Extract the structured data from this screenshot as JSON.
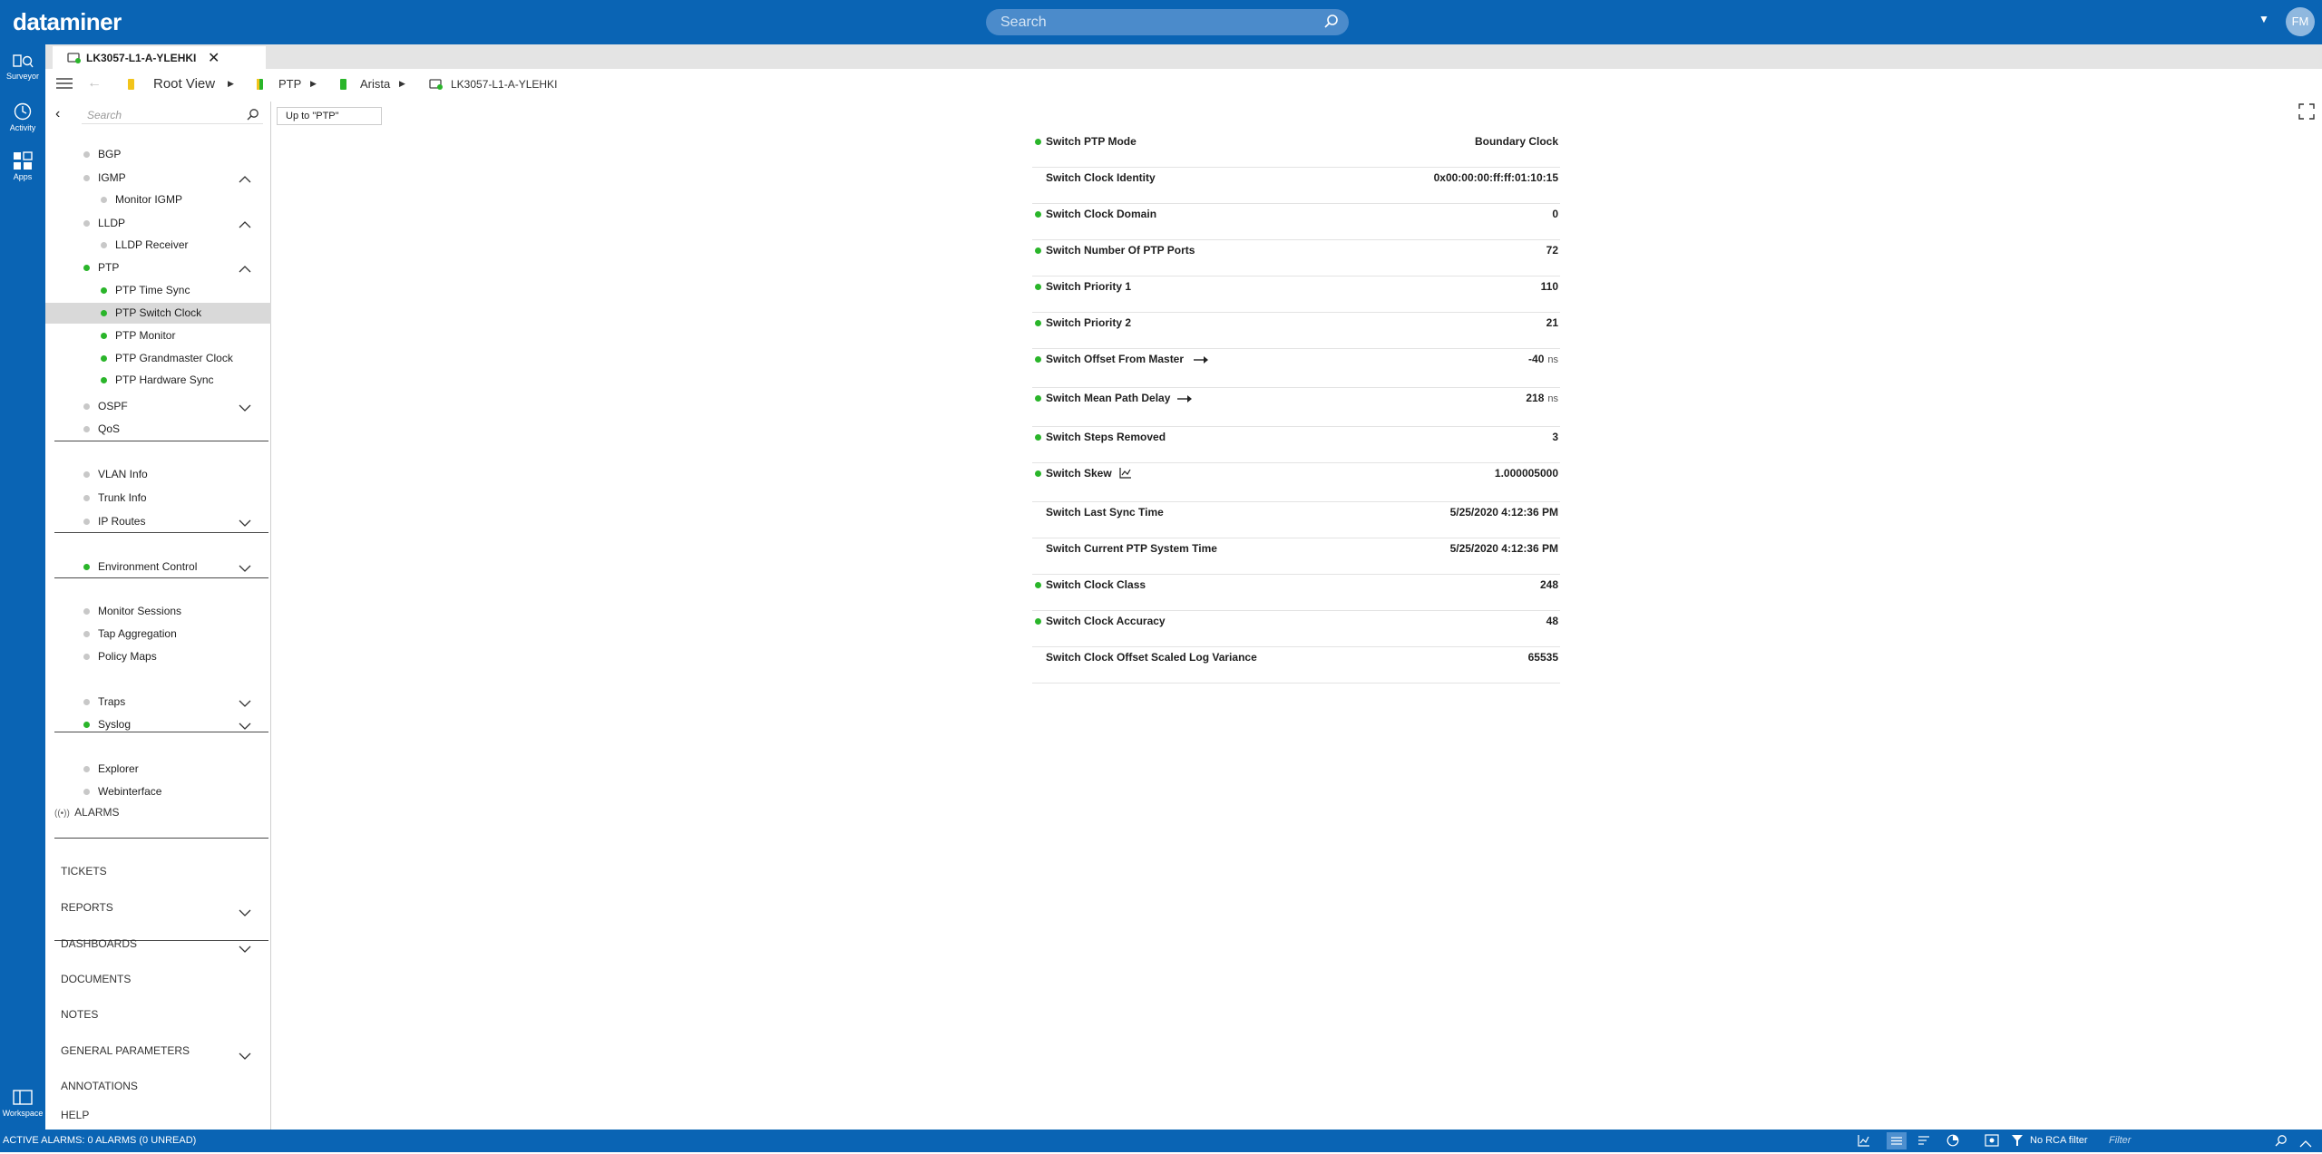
{
  "app": {
    "logo": "dataminer",
    "search_placeholder": "Search",
    "avatar_initials": "FM"
  },
  "rail": {
    "items": [
      {
        "label": "Surveyor"
      },
      {
        "label": "Activity"
      },
      {
        "label": "Apps"
      }
    ],
    "bottom": {
      "label": "Workspace"
    }
  },
  "tab": {
    "title": "LK3057-L1-A-YLEHKI"
  },
  "breadcrumb": [
    "Root View",
    "PTP",
    "Arista",
    "LK3057-L1-A-YLEHKI"
  ],
  "sidebar": {
    "search_placeholder": "Search",
    "items": [
      {
        "label": "BGP",
        "status": "grey",
        "indent": 1
      },
      {
        "label": "IGMP",
        "status": "grey",
        "indent": 1,
        "chevron": "up"
      },
      {
        "label": "Monitor IGMP",
        "status": "grey",
        "indent": 2
      },
      {
        "label": "LLDP",
        "status": "grey",
        "indent": 1,
        "chevron": "up"
      },
      {
        "label": "LLDP Receiver",
        "status": "grey",
        "indent": 2
      },
      {
        "label": "PTP",
        "status": "green",
        "indent": 1,
        "chevron": "up"
      },
      {
        "label": "PTP Time Sync",
        "status": "green",
        "indent": 2
      },
      {
        "label": "PTP Switch Clock",
        "status": "green",
        "indent": 2,
        "selected": true
      },
      {
        "label": "PTP Monitor",
        "status": "green",
        "indent": 2
      },
      {
        "label": "PTP Grandmaster Clock",
        "status": "green",
        "indent": 2
      },
      {
        "label": "PTP Hardware Sync",
        "status": "green",
        "indent": 2
      },
      {
        "label": "OSPF",
        "status": "grey",
        "indent": 1,
        "chevron": "down"
      },
      {
        "label": "QoS",
        "status": "grey",
        "indent": 1
      },
      {
        "label": "VLAN Info",
        "status": "grey",
        "indent": 1
      },
      {
        "label": "Trunk Info",
        "status": "grey",
        "indent": 1
      },
      {
        "label": "IP Routes",
        "status": "grey",
        "indent": 1,
        "chevron": "down"
      },
      {
        "label": "Environment Control",
        "status": "green",
        "indent": 1,
        "chevron": "down"
      },
      {
        "label": "Monitor Sessions",
        "status": "grey",
        "indent": 1
      },
      {
        "label": "Tap Aggregation",
        "status": "grey",
        "indent": 1
      },
      {
        "label": "Policy Maps",
        "status": "grey",
        "indent": 1
      },
      {
        "label": "Traps",
        "status": "grey",
        "indent": 1,
        "chevron": "down"
      },
      {
        "label": "Syslog",
        "status": "green",
        "indent": 1,
        "chevron": "down"
      },
      {
        "label": "Explorer",
        "status": "grey",
        "indent": 1
      },
      {
        "label": "Webinterface",
        "status": "grey",
        "indent": 1
      }
    ],
    "alarms_label": "ALARMS",
    "sections": [
      {
        "label": "TICKETS"
      },
      {
        "label": "REPORTS",
        "chevron": "down"
      },
      {
        "label": "DASHBOARDS",
        "chevron": "down"
      },
      {
        "label": "DOCUMENTS"
      },
      {
        "label": "NOTES"
      },
      {
        "label": "GENERAL PARAMETERS",
        "chevron": "down"
      },
      {
        "label": "ANNOTATIONS"
      },
      {
        "label": "HELP"
      }
    ]
  },
  "main": {
    "up_button": "Up to \"PTP\""
  },
  "parameters": [
    {
      "name": "Switch PTP Mode",
      "value": "Boundary Clock",
      "status": true
    },
    {
      "name": "Switch Clock Identity",
      "value": "0x00:00:00:ff:ff:01:10:15",
      "status": false
    },
    {
      "name": "Switch Clock Domain",
      "value": "0",
      "status": true
    },
    {
      "name": "Switch Number Of PTP Ports",
      "value": "72",
      "status": true
    },
    {
      "name": "Switch Priority 1",
      "value": "110",
      "status": true
    },
    {
      "name": "Switch Priority 2",
      "value": "21",
      "status": true
    },
    {
      "name": "Switch Offset From Master",
      "value": "-40",
      "unit": "ns",
      "status": true,
      "trend": "arrow-right"
    },
    {
      "name": "Switch Mean Path Delay",
      "value": "218",
      "unit": "ns",
      "status": true,
      "trend": "arrow-right"
    },
    {
      "name": "Switch Steps Removed",
      "value": "3",
      "status": true
    },
    {
      "name": "Switch Skew",
      "value": "1.000005000",
      "status": true,
      "trend": "chart"
    },
    {
      "name": "Switch Last Sync Time",
      "value": "5/25/2020 4:12:36 PM",
      "status": false
    },
    {
      "name": "Switch Current PTP System Time",
      "value": "5/25/2020 4:12:36 PM",
      "status": false
    },
    {
      "name": "Switch Clock Class",
      "value": "248",
      "status": true
    },
    {
      "name": "Switch Clock Accuracy",
      "value": "48",
      "status": true
    },
    {
      "name": "Switch Clock Offset Scaled Log Variance",
      "value": "65535",
      "status": false
    }
  ],
  "statusbar": {
    "alarms": "ACTIVE ALARMS: 0 ALARMS (0 UNREAD)",
    "rca": "No RCA filter",
    "filter_placeholder": "Filter"
  },
  "colors": {
    "brand": "#0a64b4",
    "ok": "#2ab52a",
    "idle": "#c8c8c8",
    "selected": "#d9d9d9"
  }
}
